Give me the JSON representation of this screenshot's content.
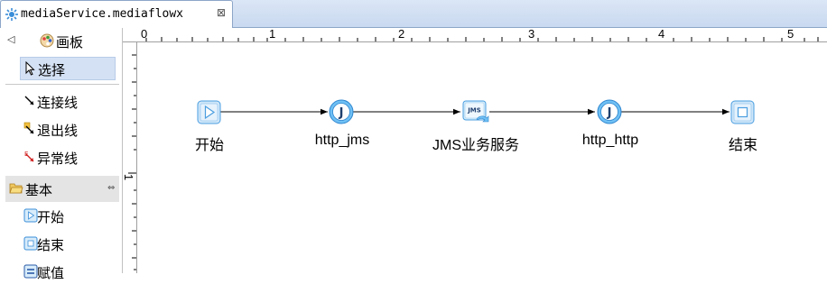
{
  "editor_tab": {
    "title": "mediaService.mediaflowx",
    "close_glyph": "⊠"
  },
  "palette": {
    "header_label": "画板",
    "tools": [
      {
        "label": "选择",
        "icon": "arrow-pointer-icon",
        "selected": true
      },
      {
        "label": "连接线",
        "icon": "connection-line-icon"
      },
      {
        "label": "退出线",
        "icon": "exit-line-icon"
      },
      {
        "label": "异常线",
        "icon": "exception-line-icon"
      }
    ],
    "drawer": {
      "label": "基本",
      "icon": "folder-open-icon"
    },
    "basic_items": [
      {
        "label": "开始",
        "icon": "start-icon"
      },
      {
        "label": "结束",
        "icon": "end-icon"
      },
      {
        "label": "赋值",
        "icon": "assign-icon"
      }
    ]
  },
  "ruler": {
    "top_labels": [
      "0",
      "1",
      "2",
      "3",
      "4",
      "5"
    ],
    "left_labels": [
      "1"
    ]
  },
  "flow": {
    "nodes": [
      {
        "label": "开始",
        "icon": "start-node-icon"
      },
      {
        "label": "http_jms",
        "icon": "java-node-icon",
        "glyph": "J"
      },
      {
        "label": "JMS业务服务",
        "icon": "jms-service-icon",
        "glyph": "JMS"
      },
      {
        "label": "http_http",
        "icon": "java-node-icon",
        "glyph": "J"
      },
      {
        "label": "结束",
        "icon": "end-node-icon"
      }
    ]
  },
  "colors": {
    "accent": "#2a7fd0",
    "tab_bar": "#c9d9f0",
    "selection": "#d4e1f4"
  }
}
